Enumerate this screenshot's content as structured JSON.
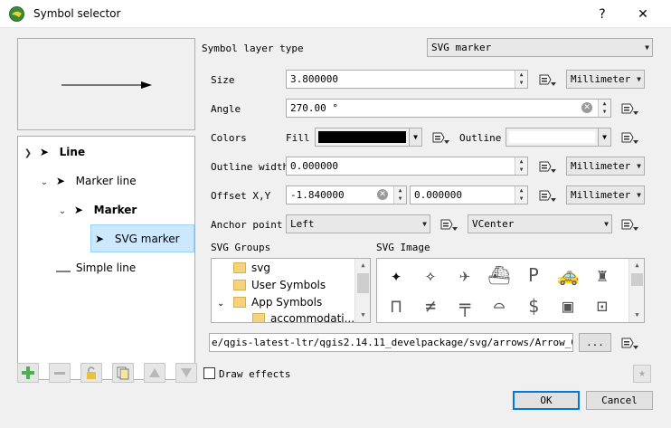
{
  "window": {
    "title": "Symbol selector",
    "help_glyph": "?",
    "close_glyph": "✕"
  },
  "tree": {
    "items": [
      {
        "label": "Line",
        "bold": true,
        "expander": "❯"
      },
      {
        "label": "Marker line",
        "bold": false,
        "expander": "⌄"
      },
      {
        "label": "Marker",
        "bold": true,
        "expander": "⌄"
      },
      {
        "label": "SVG marker",
        "bold": false,
        "selected": true
      },
      {
        "label": "Simple line",
        "bold": false
      }
    ]
  },
  "form": {
    "symbol_layer_type_label": "Symbol layer type",
    "symbol_layer_type_value": "SVG marker",
    "size_label": "Size",
    "size_value": "3.800000",
    "size_unit": "Millimeter",
    "angle_label": "Angle",
    "angle_value": "270.00 °",
    "colors_label": "Colors",
    "fill_label": "Fill",
    "fill_color": "#000000",
    "outline_label": "Outline",
    "outline_color": "#ffffff",
    "outline_width_label": "Outline width",
    "outline_width_value": "0.000000",
    "outline_width_unit": "Millimeter",
    "offset_label": "Offset X,Y",
    "offset_x": "-1.840000",
    "offset_y": "0.000000",
    "offset_unit": "Millimeter",
    "anchor_label": "Anchor point",
    "anchor_h": "Left",
    "anchor_v": "VCenter",
    "svg_groups_label": "SVG Groups",
    "svg_image_label": "SVG Image",
    "svg_groups": [
      {
        "label": "svg",
        "indent": 1
      },
      {
        "label": "User Symbols",
        "indent": 1
      },
      {
        "label": "App Symbols",
        "indent": 1,
        "expander": "⌄"
      },
      {
        "label": "accommodati...",
        "indent": 2
      }
    ],
    "svg_path": "e/qgis-latest-ltr/qgis2.14.11_develpackage/svg/arrows/Arrow_05.svg",
    "browse_label": "...",
    "draw_effects_label": "Draw effects"
  },
  "svg_images": [
    {
      "name": "star-icon",
      "glyph": "✦"
    },
    {
      "name": "sparkle-icon",
      "glyph": "✧"
    },
    {
      "name": "airplane-icon",
      "glyph": "✈"
    },
    {
      "name": "ship-icon",
      "glyph": "⛴"
    },
    {
      "name": "parking-icon",
      "glyph": "P"
    },
    {
      "name": "taxi-icon",
      "glyph": "🚕"
    },
    {
      "name": "bollard-icon",
      "glyph": "♜"
    },
    {
      "name": "gate-icon",
      "glyph": "⊓"
    },
    {
      "name": "crossing-icon",
      "glyph": "≠"
    },
    {
      "name": "barrier-icon",
      "glyph": "╤"
    },
    {
      "name": "bridge-icon",
      "glyph": "⌓"
    },
    {
      "name": "toll-icon",
      "glyph": "$"
    },
    {
      "name": "train-icon",
      "glyph": "▣"
    },
    {
      "name": "tram-icon",
      "glyph": "⊡"
    }
  ],
  "buttons": {
    "ok": "OK",
    "cancel": "Cancel"
  }
}
